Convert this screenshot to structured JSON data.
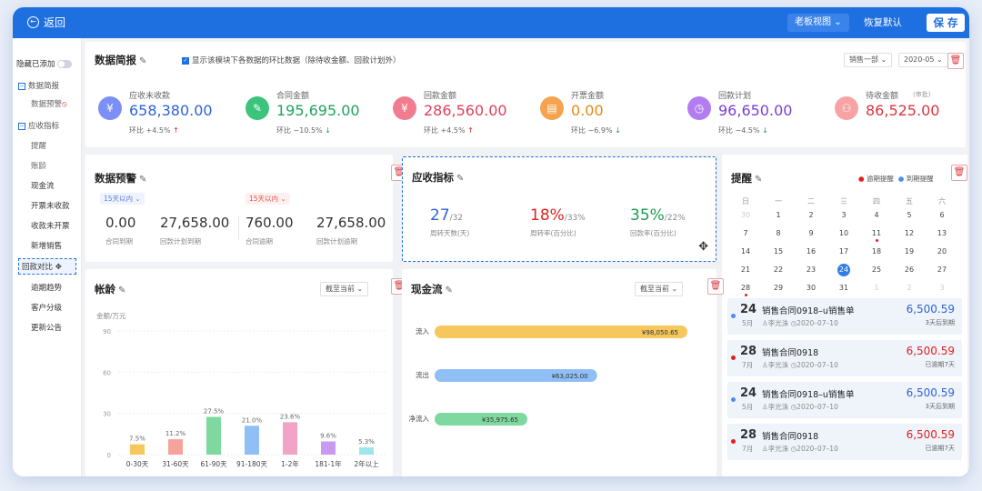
{
  "topbar": {
    "back": "返回",
    "view": "老板视图",
    "restore": "恢复默认",
    "save": "保 存"
  },
  "sidebar": {
    "hide_added": "隐藏已添加",
    "items": [
      "数据简报",
      "数据预警",
      "应收指标",
      "提醒",
      "账龄",
      "现金流",
      "开票未收款",
      "收款未开票",
      "新增销售",
      "回款对比",
      "逾期趋势",
      "客户分级",
      "更新公告"
    ]
  },
  "brief": {
    "title": "数据简报",
    "checkbox": "显示该模块下各数据的环比数据（除待收金额、回款计划外）",
    "dept": "销售一部",
    "month": "2020-05",
    "metrics": [
      {
        "label": "应收未收款",
        "value": "658,380.00",
        "cmp": "环比 +4.5%",
        "dir": "up",
        "icon": "¥",
        "color": "#7b8ff7",
        "vcolor": "#2f63d8"
      },
      {
        "label": "合同金额",
        "value": "195,695.00",
        "cmp": "环比 −10.5%",
        "dir": "down",
        "icon": "✎",
        "color": "#3cc47b",
        "vcolor": "#1ea35c"
      },
      {
        "label": "回款金额",
        "value": "286,560.00",
        "cmp": "环比 +4.5%",
        "dir": "up",
        "icon": "¥",
        "color": "#f27c8f",
        "vcolor": "#e0405a"
      },
      {
        "label": "开票金额",
        "value": "0.00",
        "cmp": "环比 −6.9%",
        "dir": "down",
        "icon": "▤",
        "color": "#f6a34f",
        "vcolor": "#e38a17"
      },
      {
        "label": "回款计划",
        "value": "96,650.00",
        "cmp": "环比 −4.5%",
        "dir": "down",
        "icon": "◷",
        "color": "#b37cf0",
        "vcolor": "#7b3ed8"
      },
      {
        "label": "待收金额",
        "value": "86,525.00",
        "cmp": "",
        "dir": "",
        "icon": "⚇",
        "color": "#f8a3a3",
        "vcolor": "#d9363e",
        "note": "(审批)"
      }
    ]
  },
  "warn": {
    "title": "数据预警",
    "tag1": "15天以内",
    "tag2": "15天以内",
    "vals": [
      {
        "v": "0.00",
        "l": "合同到期"
      },
      {
        "v": "27,658.00",
        "l": "回款计划到期"
      },
      {
        "v": "760.00",
        "l": "合同逾期"
      },
      {
        "v": "27,658.00",
        "l": "回款计划逾期"
      }
    ]
  },
  "recv": {
    "title": "应收指标",
    "items": [
      {
        "main": "27",
        "sub": "/32",
        "label": "周转天数(天)",
        "color": "#2f63d8"
      },
      {
        "main": "18%",
        "sub": "/33%",
        "label": "周转率(百分比)",
        "color": "#e02020"
      },
      {
        "main": "35%",
        "sub": "/22%",
        "label": "回款率(百分比)",
        "color": "#1a9c52"
      }
    ]
  },
  "remind": {
    "title": "提醒",
    "legend1": "逾期提醒",
    "legend2": "到期提醒",
    "weekdays": [
      "日",
      "一",
      "二",
      "三",
      "四",
      "五",
      "六"
    ],
    "days": [
      "30",
      "1",
      "2",
      "3",
      "4",
      "5",
      "6",
      "7",
      "8",
      "9",
      "10",
      "11",
      "12",
      "13",
      "14",
      "15",
      "16",
      "17",
      "18",
      "19",
      "20",
      "21",
      "22",
      "23",
      "24",
      "25",
      "26",
      "27",
      "28",
      "29",
      "30",
      "31",
      "1",
      "2",
      "3"
    ],
    "items": [
      {
        "day": "24",
        "month": "5月",
        "title": "销售合同0918–u销售单",
        "person": "李光洙",
        "date": "2020–07–10",
        "amount": "6,500.59",
        "status": "3天后到期",
        "type": "due"
      },
      {
        "day": "28",
        "month": "7月",
        "title": "销售合同0918",
        "person": "李光洙",
        "date": "2020–07–10",
        "amount": "6,500.59",
        "status": "已逾期7天",
        "type": "overdue"
      },
      {
        "day": "24",
        "month": "5月",
        "title": "销售合同0918–u销售单",
        "person": "李光洙",
        "date": "2020–07–10",
        "amount": "6,500.59",
        "status": "3天后到期",
        "type": "due"
      },
      {
        "day": "28",
        "month": "7月",
        "title": "销售合同0918",
        "person": "李光洙",
        "date": "2020–07–10",
        "amount": "6,500.59",
        "status": "已逾期7天",
        "type": "overdue"
      }
    ]
  },
  "aging": {
    "title": "帐龄",
    "filter": "截至当前",
    "unit": "金额/万元"
  },
  "cash": {
    "title": "现金流",
    "filter": "截至当前"
  },
  "chart_data": [
    {
      "type": "bar",
      "categories": [
        "0-30天",
        "31-60天",
        "61-90天",
        "91-180天",
        "1-2年",
        "181-1年",
        "2年以上"
      ],
      "values": [
        7.5,
        11.2,
        27.5,
        21.0,
        23.6,
        9.6,
        5.3
      ],
      "labels": [
        "7.5%",
        "11.2%",
        "27.5%",
        "21.0%",
        "23.6%",
        "9.6%",
        "5.3%"
      ],
      "colors": [
        "#f6c75c",
        "#f5a29a",
        "#7fd89f",
        "#8fbff5",
        "#f2a3c6",
        "#c89af2",
        "#9fe6ec"
      ],
      "yticks": [
        0,
        30,
        60,
        90
      ],
      "ylim": [
        0,
        90
      ],
      "ylabel": "金额/万元"
    },
    {
      "type": "bar",
      "orientation": "horizontal",
      "categories": [
        "流入",
        "流出",
        "净流入"
      ],
      "values": [
        98050.65,
        63025.0,
        35975.65
      ],
      "labels": [
        "¥98,050.65",
        "¥63,025.00",
        "¥35,975.65"
      ],
      "colors": [
        "#f6c75c",
        "#8fbff5",
        "#7fd89f"
      ]
    }
  ]
}
